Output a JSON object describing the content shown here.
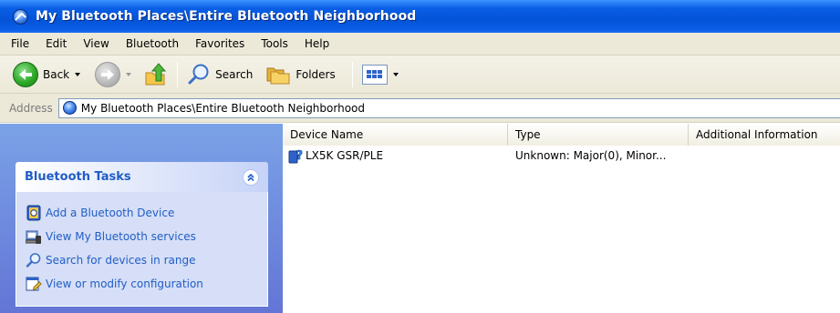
{
  "window": {
    "title": "My Bluetooth Places\\Entire Bluetooth Neighborhood",
    "icon": "bluetooth-places-icon"
  },
  "menubar": {
    "items": [
      "File",
      "Edit",
      "View",
      "Bluetooth",
      "Favorites",
      "Tools",
      "Help"
    ]
  },
  "toolbar": {
    "back_label": "Back",
    "search_label": "Search",
    "folders_label": "Folders"
  },
  "address": {
    "label": "Address",
    "value": "My Bluetooth Places\\Entire Bluetooth Neighborhood"
  },
  "taskpane": {
    "title": "Bluetooth Tasks",
    "items": [
      {
        "label": "Add a Bluetooth Device",
        "icon": "add-device-icon"
      },
      {
        "label": "View My Bluetooth services",
        "icon": "services-icon"
      },
      {
        "label": "Search for devices in range",
        "icon": "search-icon"
      },
      {
        "label": "View or modify configuration",
        "icon": "configuration-icon"
      }
    ]
  },
  "listview": {
    "columns": [
      "Device Name",
      "Type",
      "Additional Information"
    ],
    "rows": [
      {
        "name": "LX5K GSR/PLE",
        "type": "Unknown: Major(0), Minor...",
        "info": "",
        "icon": "unknown-device-icon"
      }
    ]
  },
  "colors": {
    "titlebar": "#0453d8",
    "taskpane_bg": "#6f8fe0",
    "task_link": "#215dc6",
    "chrome": "#ece9d8"
  }
}
